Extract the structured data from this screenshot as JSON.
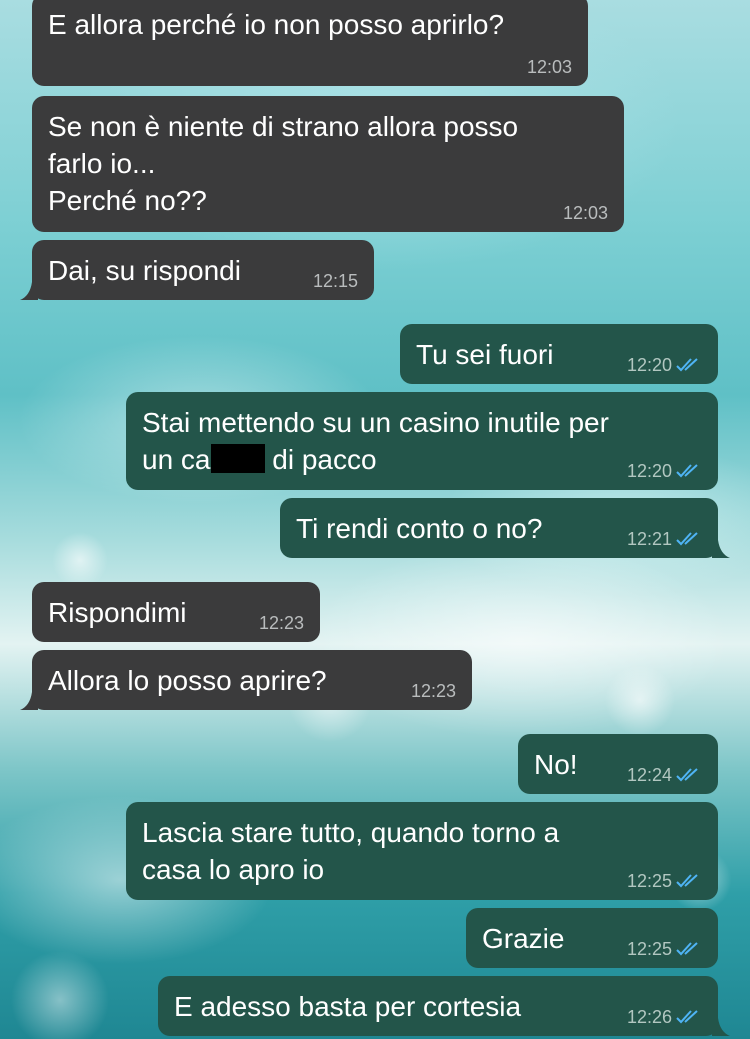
{
  "colors": {
    "incoming_bubble": "#3b3b3c",
    "outgoing_bubble": "#23554a",
    "read_receipt": "#4fb4f5",
    "timestamp": "#b9bcbd"
  },
  "messages": [
    {
      "direction": "incoming",
      "text": "E allora perché io non posso aprirlo?",
      "time": "12:03"
    },
    {
      "direction": "incoming",
      "text": "Se non è niente di strano allora posso\nfarlo io...\nPerché no??",
      "time": "12:03"
    },
    {
      "direction": "incoming",
      "text": "Dai, su rispondi",
      "time": "12:15"
    },
    {
      "direction": "outgoing",
      "text": "Tu sei fuori",
      "time": "12:20",
      "status": "read-double-check-icon"
    },
    {
      "direction": "outgoing",
      "text_line1": "Stai mettendo su un casino inutile per",
      "text_line2_prefix": "un ca",
      "text_line2_suffix": "di pacco",
      "redacted": true,
      "time": "12:20",
      "status": "read-double-check-icon"
    },
    {
      "direction": "outgoing",
      "text": "Ti rendi conto o no?",
      "time": "12:21",
      "status": "read-double-check-icon"
    },
    {
      "direction": "incoming",
      "text": "Rispondimi",
      "time": "12:23"
    },
    {
      "direction": "incoming",
      "text": "Allora lo posso aprire?",
      "time": "12:23"
    },
    {
      "direction": "outgoing",
      "text": "No!",
      "time": "12:24",
      "status": "read-double-check-icon"
    },
    {
      "direction": "outgoing",
      "text": "Lascia stare tutto, quando torno a\ncasa lo apro io",
      "time": "12:25",
      "status": "read-double-check-icon"
    },
    {
      "direction": "outgoing",
      "text": "Grazie",
      "time": "12:25",
      "status": "read-double-check-icon"
    },
    {
      "direction": "outgoing",
      "text": "E adesso basta per cortesia",
      "time": "12:26",
      "status": "read-double-check-icon"
    }
  ]
}
